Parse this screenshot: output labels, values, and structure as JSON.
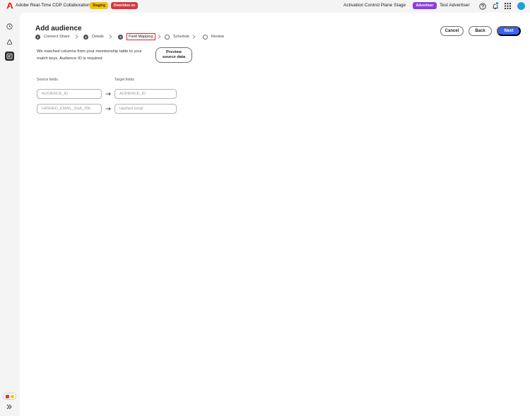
{
  "header": {
    "app_title": "Adobe Real-Time CDP Collaboration",
    "staging_badge": "Staging",
    "overrides_badge": "Overrides on",
    "org_name": "Activation Control Plane Stage",
    "role_badge": "Advertiser",
    "user_name": "Test Advertiser",
    "icons": [
      "adobe-logo-icon",
      "help-icon",
      "bell-icon",
      "apps-grid-icon",
      "avatar"
    ]
  },
  "sidebar": {
    "items": [
      {
        "icon": "history-icon",
        "active": false
      },
      {
        "icon": "recycle-icon",
        "active": false
      },
      {
        "icon": "audience-icon",
        "active": true
      }
    ],
    "expand_icon": "expand-double-chevron-icon"
  },
  "page": {
    "title": "Add audience",
    "steps": [
      {
        "number": "1",
        "label": "Connect Share",
        "state": "complete"
      },
      {
        "number": "2",
        "label": "Details",
        "state": "complete"
      },
      {
        "number": "3",
        "label": "Field Mapping",
        "state": "current"
      },
      {
        "number": "",
        "label": "Schedule",
        "state": "upcoming"
      },
      {
        "number": "",
        "label": "Review",
        "state": "upcoming"
      }
    ],
    "cancel_label": "Cancel",
    "back_label": "Back",
    "next_label": "Next",
    "description": "We matched columns from your membership table to your match keys. Audience ID is required.",
    "preview_label": "Preview source data",
    "source_header": "Source fields",
    "target_header": "Target fields",
    "mappings": [
      {
        "source": "AUDIENCE_ID",
        "target": "AUDIENCE_ID"
      },
      {
        "source": "HASHED_EMAIL_SHA_256",
        "target": "Hashed email"
      }
    ]
  },
  "colors": {
    "accent_blue": "#3b63fb",
    "advertiser_purple": "#8d3fd8",
    "staging_yellow": "#f5c400",
    "overrides_red": "#d7373f",
    "highlight_red": "#e0262b"
  }
}
